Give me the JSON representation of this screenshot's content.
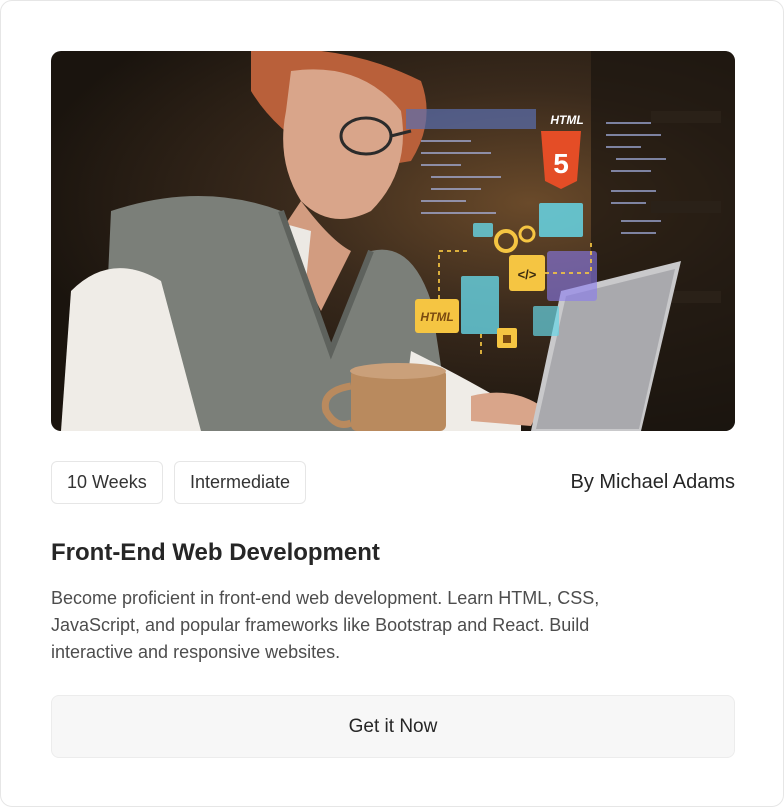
{
  "course": {
    "image_alt": "Woman using laptop with holographic code overlay",
    "hero_labels": {
      "html5": "HTML",
      "html_card": "HTML",
      "code_tag": "</>"
    },
    "tags": [
      {
        "label": "10 Weeks"
      },
      {
        "label": "Intermediate"
      }
    ],
    "author": "By Michael Adams",
    "title": "Front-End Web Development",
    "description": "Become proficient in front-end web development. Learn HTML, CSS, JavaScript, and popular frameworks like Bootstrap and React. Build interactive and responsive websites.",
    "cta_label": "Get it Now"
  },
  "colors": {
    "card_border": "#e6e6e6",
    "button_bg": "#f7f7f7",
    "text_primary": "#262626",
    "text_secondary": "#4d4d4d",
    "accent_html5": "#e44d26",
    "accent_yellow": "#f5c542"
  }
}
